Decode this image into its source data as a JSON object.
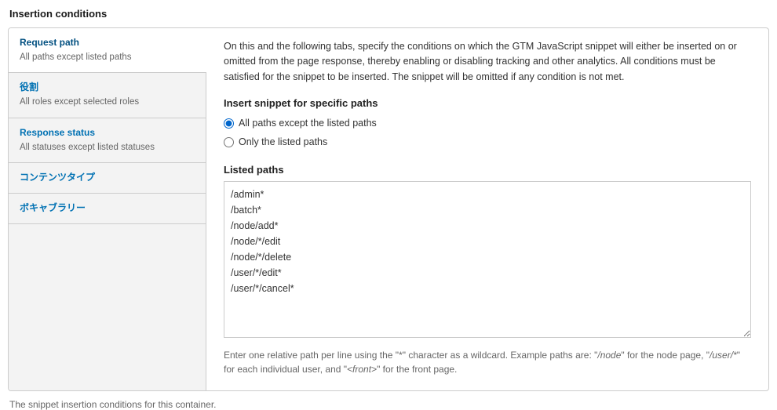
{
  "page_title": "Insertion conditions",
  "tabs": [
    {
      "title": "Request path",
      "summary": "All paths except listed paths"
    },
    {
      "title": "役割",
      "summary": "All roles except selected roles"
    },
    {
      "title": "Response status",
      "summary": "All statuses except listed statuses"
    },
    {
      "title": "コンテンツタイプ",
      "summary": ""
    },
    {
      "title": "ボキャブラリー",
      "summary": ""
    }
  ],
  "intro": "On this and the following tabs, specify the conditions on which the GTM JavaScript snippet will either be inserted on or omitted from the page response, thereby enabling or disabling tracking and other analytics. All conditions must be satisfied for the snippet to be inserted. The snippet will be omitted if any condition is not met.",
  "radio_group_label": "Insert snippet for specific paths",
  "radio_options": {
    "all_except": "All paths except the listed paths",
    "only_listed": "Only the listed paths"
  },
  "listed_label": "Listed paths",
  "listed_paths": "/admin*\n/batch*\n/node/add*\n/node/*/edit\n/node/*/delete\n/user/*/edit*\n/user/*/cancel*",
  "hint": {
    "prefix": "Enter one relative path per line using the \"*\" character as a wildcard. Example paths are: \"",
    "ex1": "/node",
    "mid1": "\" for the node page, \"",
    "ex2": "/user/*",
    "mid2": "\" for each individual user, and \"",
    "ex3": "<front>",
    "suffix": "\" for the front page."
  },
  "footer": "The snippet insertion conditions for this container."
}
